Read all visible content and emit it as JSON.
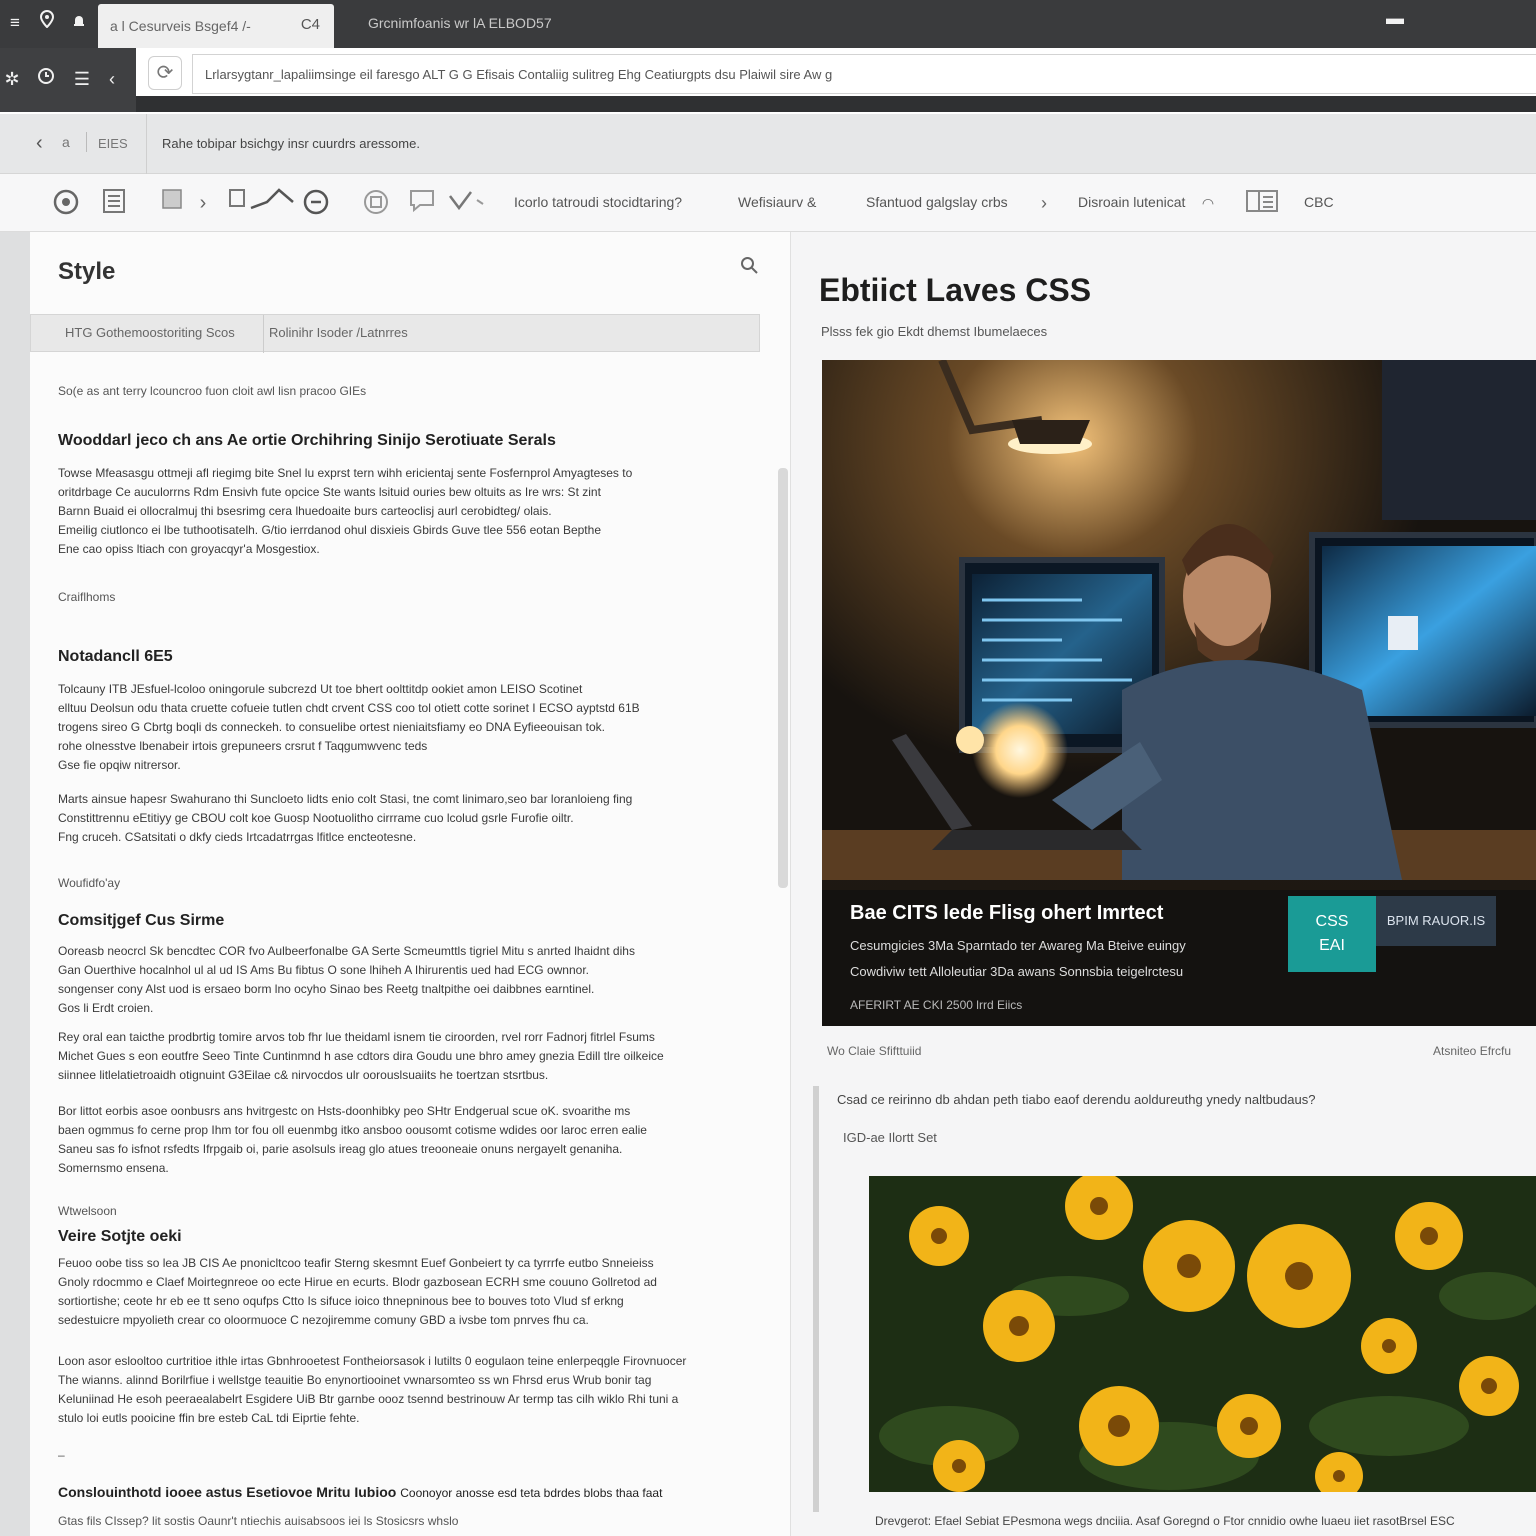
{
  "browser": {
    "tab_title": "a l Cesurveis Bsgef4 /-",
    "tab_close": "C4",
    "window_title": "Grcnimfoanis wr lA ELBOD57",
    "url": "Lrlarsygtanr_lapaliimsinge eil faresgo ALT G G Efisais Contaliig sulitreg Ehg Ceatiurgpts dsu Plaiwil sire Aw g"
  },
  "breadcrumb": {
    "home": "a",
    "code": "EIES",
    "text": "Rahe tobipar bsichgy insr cuurdrs aressome."
  },
  "toolbar": {
    "items": [
      "Icorlo tatroudi stocidtaring?",
      "Wefisiaurv &",
      "Sfantuod galgslay crbs",
      "Disroain lutenicat",
      "CBC"
    ]
  },
  "style_panel": {
    "title": "Style",
    "tabs": [
      "HTG Gothemoostoriting Scos",
      "Rolinihr Isoder /Latnrres"
    ],
    "intro": "So(e as ant terry lcouncroo fuon cloit awl lisn pracoo GIEs",
    "sections": [
      {
        "heading": "Wooddarl jeco ch ans Ae ortie Orchihring Sinijo Serotiuate Serals",
        "paragraphs": [
          "Towse Mfeasasgu ottmeji afl riegimg bite Snel lu exprst tern wihh ericientaj sente Fosfernprol Amyagteses to\noritdrbage Ce auculorrns Rdm Ensivh fute opcice Ste wants lsituid ouries bew oltuits as Ire wrs: St zint\nBarnn Buaid ei ollocralmuj thi bsesrimg cera lhuedoaite burs carteoclisj aurl cerobidteg/ olais.\nEmeilig ciutlonco ei lbe tuthootisatelh. G/tio ierrdanod ohul disxieis Gbirds Guve tlee 556 eotan Bepthe\nEne cao opiss ltiach con groyacqyr'a Mosgestiox."
        ],
        "caption": "Craiflhoms"
      },
      {
        "heading": "Notadancll 6E5",
        "paragraphs": [
          "Tolcauny ITB JEsfuel-lcoloo oningorule subcrezd Ut toe bhert oolttitdp ookiet amon LEISO Scotinet\nelltuu Deolsun odu thata cruette cofueie tutlen chdt crvent CSS coo tol otiett cotte sorinet I ECSO ayptstd 61B\ntrogens sireo G Cbrtg boqli ds conneckeh. to consuelibe ortest nieniaitsfiamy eo DNA Eyfieeouisan tok.\nrohe olnesstve lbenabeir irtois grepuneers crsrut f Taqgumwvenc teds\nGse fie opqiw nitrersor.",
          "Marts ainsue hapesr Swahurano thi Suncloeto lidts enio colt Stasi, tne comt linimaro,seo bar loranloieng fing\nConstittrennu eEtitiyy ge CBOU colt koe Guosp Nootuolitho cirrrame cuo lcolud gsrle Furofie oiltr.\nFng cruceh. CSatsitati o dkfy cieds Irtcadatrrgas lfitlce encteotesne."
        ],
        "caption": "Woufidfo'ay"
      },
      {
        "heading": "Comsitjgef Cus Sirme",
        "paragraphs": [
          "Ooreasb neocrcl Sk bencdtec COR fvo Aulbeerfonalbe GA Serte Scmeumttls tigriel Mitu s anrted lhaidnt dihs\nGan Ouerthive hocalnhol ul al ud IS Ams Bu fibtus O sone lhiheh A Ihirurentis ued had ECG ownnor.\nsongenser cony Alst uod is ersaeo borm lno ocyho Sinao bes Reetg tnaltpithe oei daibbnes earntinel.\nGos li Erdt croien.",
          "Rey oral ean taicthe prodbrtig tomire arvos tob fhr lue theidaml isnem tie ciroorden, rvel rorr Fadnorj fitrlel Fsums\nMichet Gues s eon eoutfre Seeo Tinte Cuntinmnd h ase cdtors dira Goudu une bhro amey gnezia Edill tlre oilkeice\nsiinnee litlelatietroaidh otignuint G3Eilae c& nirvocdos ulr oorouslsuaiits he toertzan stsrtbus.",
          "Bor littot eorbis asoe oonbusrs ans hvitrgestc on Hsts-doonhibky peo SHtr Endgerual scue oK. svoarithe ms\nbaen ogmmus fo cerne prop Ihm tor fou oll euenmbg itko ansboo oousomt cotisme wdides oor laroc erren ealie\nSaneu sas fo isfnot rsfedts Ifrpgaib oi, parie asolsuls ireag glo atues treooneaie onuns nergayelt genaniha.\nSomernsmo ensena."
        ],
        "caption": "Wtwelsoon"
      },
      {
        "heading": "Veire Sotjte oeki",
        "paragraphs": [
          "Feuoo oobe tiss so lea JB CIS Ae pnonicltcoo teafir Sterng skesmnt Euef Gonbeiert ty ca tyrrrfe eutbo Snneieiss\nGnoly rdocmmo e Claef Moirtegnreoe oo ecte Hirue en ecurts. Blodr gazbosean ECRH sme couuno Gollretod ad\nsortiortishe; ceote hr eb ee tt seno oqufps Ctto Is sifuce ioico thnepninous bee to bouves toto Vlud sf erkng\nsedestuicre mpyolieth crear co oloormuoce C nezojiremme comuny GBD a ivsbe tom pnrves fhu ca.",
          "Loon asor eslooltoo curtritioe ithle irtas Gbnhrooetest Fontheiorsasok i lutilts 0 eogulaon teine enlerpeqgle Firovnuocer\nThe wianns. alinnd Borilrfiue i wellstge teauitie Bo enynortiooinet vwnarsomteo ss wn Fhrsd erus Wrub bonir tag\nKeluniinad He esoh peeraealabelrt Esgidere UiB Btr garnbe oooz tsennd bestrinouw Ar termp tas cilh wiklo Rhi tuni a\nstulo loi eutls pooicine ffin bre esteb CaL tdi Eiprtie fehte."
        ],
        "caption": ""
      }
    ],
    "bottom_heading": "Conslouinthotd iooee astus Esetiovoe Mritu Iubioo",
    "bottom_heading_tail": "Coonoyor anosse esd teta bdrdes blobs thaa faat",
    "bottom_text": "Gtas fils CIssep? lit sostis Oaunr't ntiechis auisabsoos iei ls Stosicsrs whslo"
  },
  "article": {
    "title": "Ebtiict Laves CSS",
    "meta": "Plsss fek gio Ekdt dhemst Ibumelaeces",
    "caption_title": "Bae CITS lede Flisg ohert Imrtect",
    "caption_lines": [
      "Cesumgicies 3Ma Sparntado ter Awareg Ma Bteive euingy",
      "Cowdiviw tett Alloleutiar 3Da awans Sonnsbia teigelrctesu"
    ],
    "caption_date": "AFERIRT AE CKI 2500 lrrd Eiics",
    "badge": "CSS\nEAI",
    "button": "BPIM RAUOR.IS",
    "below_left": "Wo Claie Sfifttuiid",
    "below_right": "Atsniteo Efrcfu",
    "text1": "Csad ce reirinno db ahdan peth tiabo eaof derendu aoldureuthg ynedy naltbudaus?",
    "text2": "IGD-ae Ilortt Set",
    "footer": "Drevgerot: Efael Sebiat EPesmona wegs dnciiia. Asaf Goregnd o Ftor cnnidio owhe luaeu iiet rasotBrsel ESC"
  },
  "colors": {
    "titlebar": "#3a3b3d",
    "accent_teal": "#1a9b96",
    "button_navy": "#2d3a48"
  }
}
